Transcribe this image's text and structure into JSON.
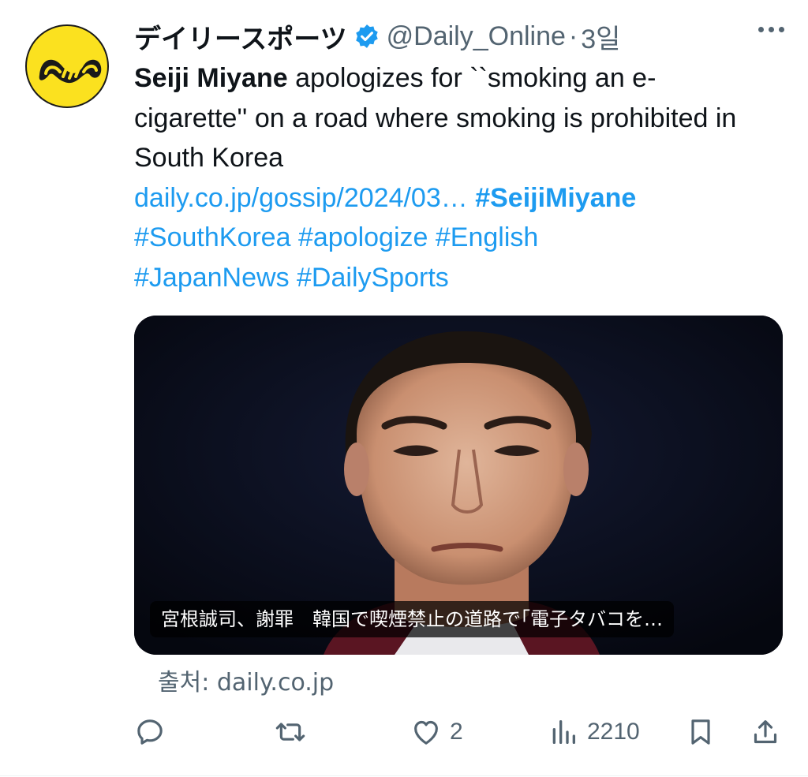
{
  "author": {
    "display_name": "デイリースポーツ",
    "handle": "@Daily_Online",
    "separator": "·",
    "time": "3일"
  },
  "tweet": {
    "bold_lead": "Seiji Miyane",
    "text": " apologizes for ``smoking an e-cigarette'' on a road where smoking is prohibited in South Korea",
    "link": "daily.co.jp/gossip/2024/03…",
    "hashtags": [
      "#SeijiMiyane",
      "#SouthKorea",
      "#apologize",
      "#English",
      "#JapanNews",
      "#DailySports"
    ]
  },
  "media": {
    "caption": "宮根誠司、謝罪　韓国で喫煙禁止の道路で｢電子タバコを…",
    "source": "출처: daily.co.jp"
  },
  "actions": {
    "reply_count": "",
    "retweet_count": "",
    "like_count": "2",
    "view_count": "2210"
  },
  "colors": {
    "accent": "#1d9bf0",
    "text": "#0f1419",
    "secondary": "#536471",
    "avatar_bg": "#fbe11f"
  },
  "icons": [
    "more-icon",
    "verified-icon",
    "reply-icon",
    "retweet-icon",
    "like-icon",
    "views-icon",
    "bookmark-icon",
    "share-icon"
  ]
}
